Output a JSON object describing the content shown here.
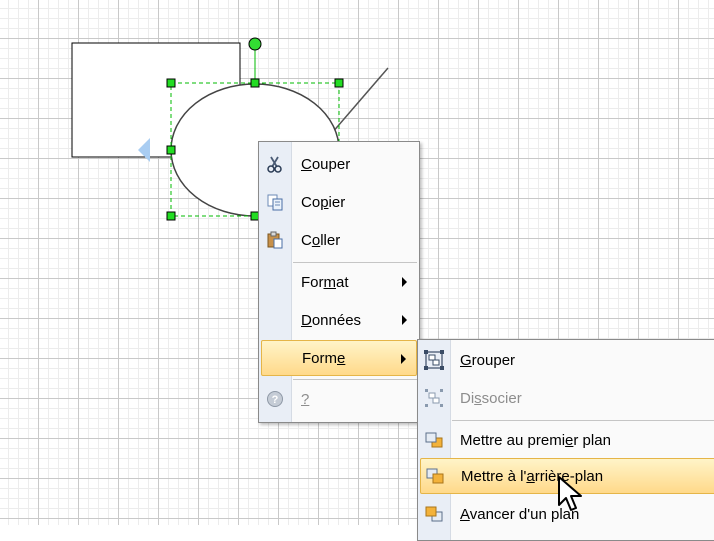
{
  "context_menu": {
    "items": [
      {
        "id": "cut",
        "pre": "",
        "key": "C",
        "post": "ouper",
        "icon": "scissors-icon",
        "disabled": false,
        "submenu": false
      },
      {
        "id": "copy",
        "pre": "Co",
        "key": "p",
        "post": "ier",
        "icon": "copy-icon",
        "disabled": false,
        "submenu": false
      },
      {
        "id": "paste",
        "pre": "C",
        "key": "o",
        "post": "ller",
        "icon": "paste-icon",
        "disabled": false,
        "submenu": false
      },
      {
        "id": "format",
        "pre": "For",
        "key": "m",
        "post": "at",
        "icon": "",
        "disabled": false,
        "submenu": true
      },
      {
        "id": "data",
        "pre": "",
        "key": "D",
        "post": "onnées",
        "icon": "",
        "disabled": false,
        "submenu": true
      },
      {
        "id": "shape",
        "pre": "Form",
        "key": "e",
        "post": "",
        "icon": "",
        "disabled": false,
        "submenu": true,
        "highlighted": true
      },
      {
        "id": "help",
        "pre": "",
        "key": "?",
        "post": "",
        "icon": "help-icon",
        "disabled": true,
        "submenu": false
      }
    ]
  },
  "shape_submenu": {
    "items": [
      {
        "id": "group",
        "pre": "",
        "key": "G",
        "post": "rouper",
        "icon": "group-icon",
        "disabled": false
      },
      {
        "id": "ungroup",
        "pre": "Di",
        "key": "s",
        "post": "socier",
        "icon": "ungroup-icon",
        "disabled": true
      },
      {
        "id": "bring-front",
        "pre": "Mettre au premi",
        "key": "e",
        "post": "r plan",
        "icon": "bring-to-front-icon",
        "disabled": false
      },
      {
        "id": "send-back",
        "pre": "Mettre à l'",
        "key": "a",
        "post": "rrière-plan",
        "icon": "send-to-back-icon",
        "disabled": false,
        "highlighted": true
      },
      {
        "id": "bring-forward",
        "pre": "",
        "key": "A",
        "post": "vancer d'un plan",
        "icon": "bring-forward-icon",
        "disabled": false
      }
    ]
  },
  "colors": {
    "handle_green": "#00dd00",
    "selection_dash": "#00bb00",
    "hover_yellow": "#ffd98a"
  }
}
